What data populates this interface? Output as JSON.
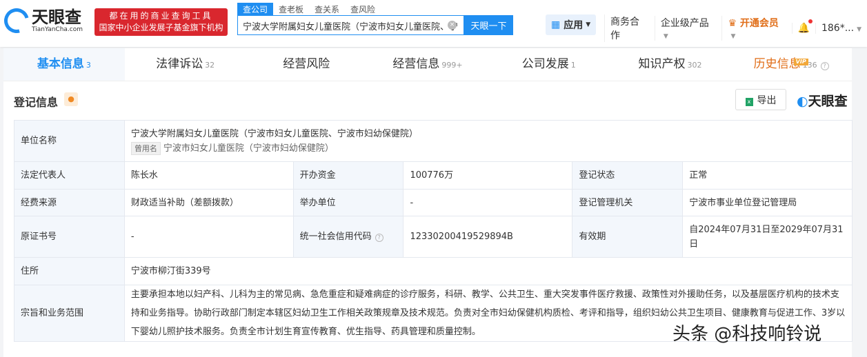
{
  "header": {
    "logo_cn": "天眼查",
    "logo_en": "TianYanCha.com",
    "slogan_line1": "都在用的商业查询工具",
    "slogan_line2": "国家中小企业发展子基金旗下机构",
    "search_tabs": [
      "查公司",
      "查老板",
      "查关系",
      "查风险"
    ],
    "search_value": "宁波大学附属妇女儿童医院（宁波市妇女儿童医院、宁",
    "clear": "×",
    "search_button": "天眼一下",
    "apps": "应用",
    "business": "商务合作",
    "enterprise": "企业级产品",
    "vip": "开通会员",
    "user": "186*..."
  },
  "tabs": [
    {
      "label": "基本信息",
      "count": "3"
    },
    {
      "label": "法律诉讼",
      "count": "32"
    },
    {
      "label": "经营风险",
      "count": ""
    },
    {
      "label": "经营信息",
      "count": "999+"
    },
    {
      "label": "公司发展",
      "count": "1"
    },
    {
      "label": "知识产权",
      "count": "302"
    },
    {
      "label": "历史信息",
      "count": "136",
      "badge": "VIP"
    }
  ],
  "section": {
    "title": "登记信息",
    "export": "导出",
    "brand": "天眼查"
  },
  "info": {
    "name_label": "单位名称",
    "name": "宁波大学附属妇女儿童医院（宁波市妇女儿童医院、宁波市妇幼保健院）",
    "former_tag": "曾用名",
    "former": "宁波市妇女儿童医院（宁波市妇幼保健院）",
    "rep_label": "法定代表人",
    "rep": "陈长水",
    "capital_label": "开办资金",
    "capital": "100776万",
    "status_label": "登记状态",
    "status": "正常",
    "funding_label": "经费来源",
    "funding": "财政适当补助（差额拨款）",
    "sponsor_label": "举办单位",
    "sponsor": "-",
    "authority_label": "登记管理机关",
    "authority": "宁波市事业单位登记管理局",
    "cert_label": "原证书号",
    "cert": "-",
    "credit_label": "统一社会信用代码",
    "credit": "12330200419529894B",
    "valid_label": "有效期",
    "valid": "自2024年07月31日至2029年07月31日",
    "address_label": "住所",
    "address": "宁波市柳汀街339号",
    "scope_label": "宗旨和业务范围",
    "scope": "主要承担本地以妇产科、儿科为主的常见病、急危重症和疑难病症的诊疗服务，科研、教学、公共卫生、重大突发事件医疗救援、政策性对外援助任务，以及基层医疗机构的技术支持和业务指导。协助行政部门制定本辖区妇幼卫生工作相关政策规章及技术规范。负责对全市妇幼保健机构质检、考评和指导，组织妇幼公共卫生项目、健康教育与促进工作、3岁以下婴幼儿照护技术服务。负责全市计划生育宣传教育、优生指导、药具管理和质量控制。"
  },
  "watermark": "头条 @科技响铃说"
}
